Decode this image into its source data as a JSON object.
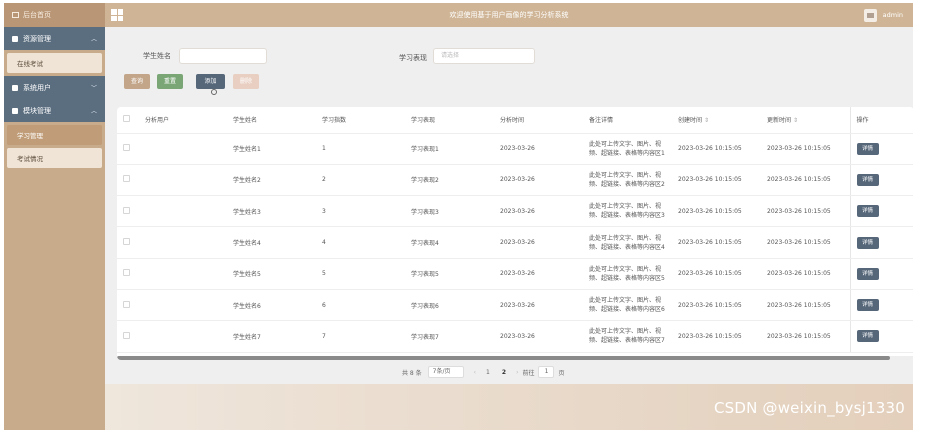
{
  "sidebar": {
    "home_label": "后台首页",
    "groups": [
      {
        "label": "资源管理",
        "items": [
          {
            "label": "在线考试"
          }
        ]
      },
      {
        "label": "系统用户",
        "items": []
      },
      {
        "label": "模块管理",
        "items": [
          {
            "label": "学习管理"
          },
          {
            "label": "考试情况"
          }
        ]
      }
    ]
  },
  "header": {
    "title": "欢迎使用基于用户画像的学习分析系统",
    "user": "admin"
  },
  "search": {
    "name_label": "学生姓名",
    "performance_label": "学习表现",
    "performance_placeholder": "请选择"
  },
  "buttons": {
    "query": "查询",
    "reset": "重置",
    "add": "添加",
    "delete": "删除"
  },
  "table": {
    "columns": [
      "分析用户",
      "学生姓名",
      "学习指数",
      "学习表现",
      "分析时间",
      "备注详情",
      "创建时间",
      "更新时间",
      "操作"
    ],
    "sort_icon": "⇕",
    "rows": [
      {
        "user": "",
        "name": "学生姓名1",
        "index": "1",
        "performance": "学习表现1",
        "time": "2023-03-26",
        "note": "此处可上传文字、图片、视频、超链接、表格等内容区1",
        "created": "2023-03-26 10:15:05",
        "updated": "2023-03-26 10:15:05",
        "action": "详情"
      },
      {
        "user": "",
        "name": "学生姓名2",
        "index": "2",
        "performance": "学习表现2",
        "time": "2023-03-26",
        "note": "此处可上传文字、图片、视频、超链接、表格等内容区2",
        "created": "2023-03-26 10:15:05",
        "updated": "2023-03-26 10:15:05",
        "action": "详情"
      },
      {
        "user": "",
        "name": "学生姓名3",
        "index": "3",
        "performance": "学习表现3",
        "time": "2023-03-26",
        "note": "此处可上传文字、图片、视频、超链接、表格等内容区3",
        "created": "2023-03-26 10:15:05",
        "updated": "2023-03-26 10:15:05",
        "action": "详情"
      },
      {
        "user": "",
        "name": "学生姓名4",
        "index": "4",
        "performance": "学习表现4",
        "time": "2023-03-26",
        "note": "此处可上传文字、图片、视频、超链接、表格等内容区4",
        "created": "2023-03-26 10:15:05",
        "updated": "2023-03-26 10:15:05",
        "action": "详情"
      },
      {
        "user": "",
        "name": "学生姓名5",
        "index": "5",
        "performance": "学习表现5",
        "time": "2023-03-26",
        "note": "此处可上传文字、图片、视频、超链接、表格等内容区5",
        "created": "2023-03-26 10:15:05",
        "updated": "2023-03-26 10:15:05",
        "action": "详情"
      },
      {
        "user": "",
        "name": "学生姓名6",
        "index": "6",
        "performance": "学习表现6",
        "time": "2023-03-26",
        "note": "此处可上传文字、图片、视频、超链接、表格等内容区6",
        "created": "2023-03-26 10:15:05",
        "updated": "2023-03-26 10:15:05",
        "action": "详情"
      },
      {
        "user": "",
        "name": "学生姓名7",
        "index": "7",
        "performance": "学习表现7",
        "time": "2023-03-26",
        "note": "此处可上传文字、图片、视频、超链接、表格等内容区7",
        "created": "2023-03-26 10:15:05",
        "updated": "2023-03-26 10:15:05",
        "action": "详情"
      }
    ]
  },
  "pager": {
    "total": "共 8 条",
    "page_size": "7条/页",
    "pages": [
      "1",
      "2"
    ],
    "current_page": "2",
    "goto_label": "前往",
    "goto_value": "1",
    "page_unit": "页"
  },
  "watermark": "CSDN @weixin_bysj1330",
  "colors": {
    "sidebar": "#c8ab8a",
    "header": "#cfb596",
    "menu_head": "#5b6e80",
    "primary_button": "#56677a",
    "reset_button": "#7aa676"
  }
}
